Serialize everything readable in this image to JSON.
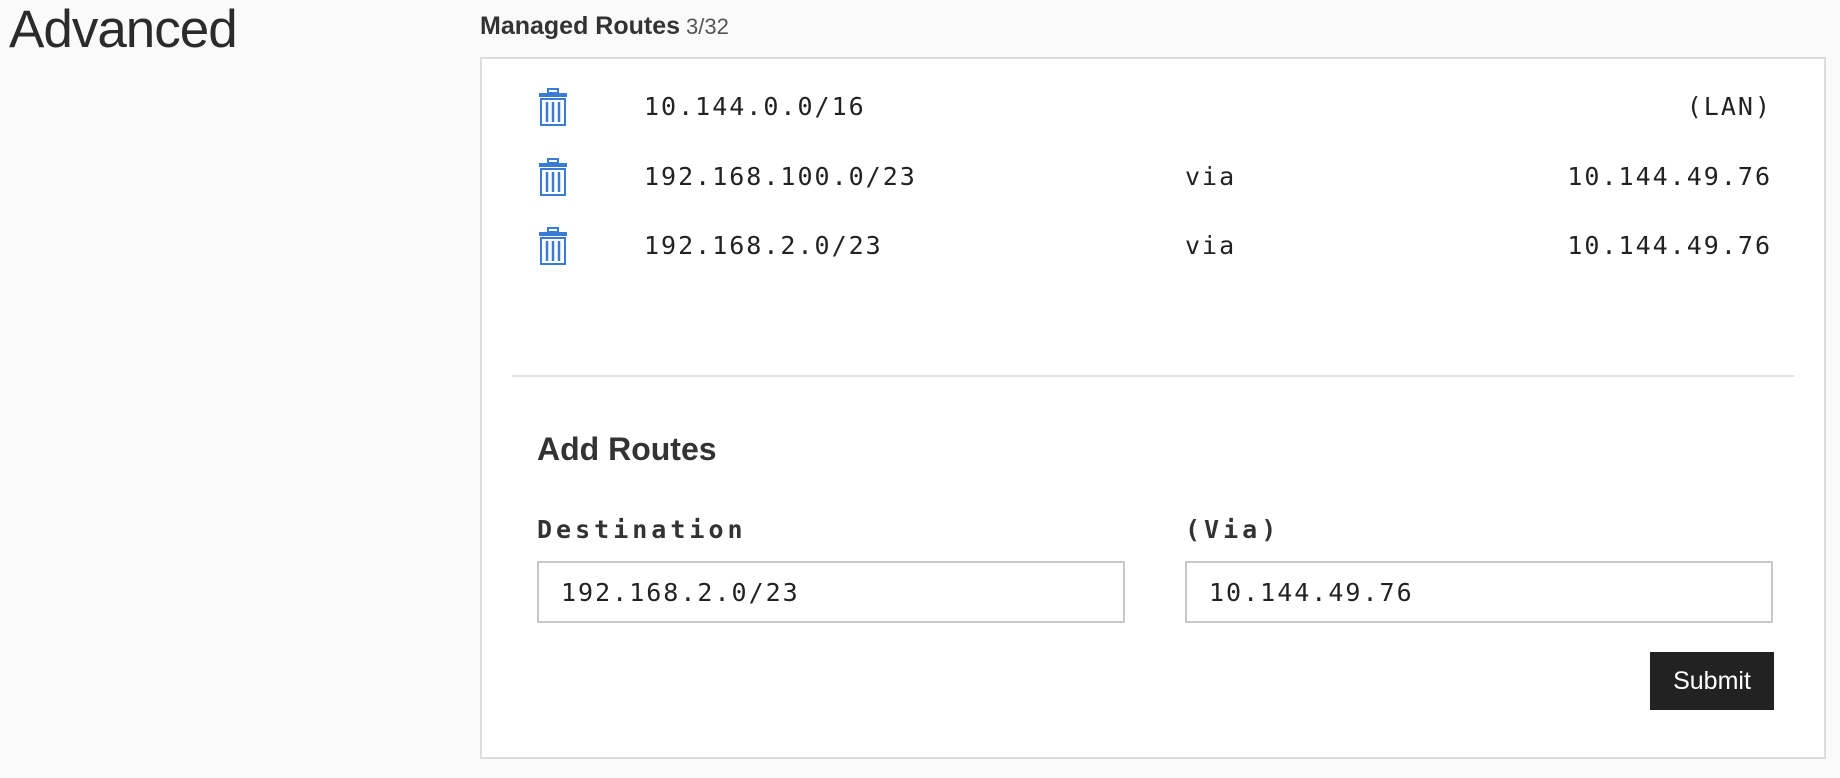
{
  "page": {
    "title": "Advanced"
  },
  "managed_routes": {
    "title": "Managed Routes",
    "count": "3/32",
    "routes": [
      {
        "destination": "10.144.0.0/16",
        "via": "",
        "gateway": "(LAN)",
        "delete_icon": "trash-icon"
      },
      {
        "destination": "192.168.100.0/23",
        "via": "via",
        "gateway": "10.144.49.76",
        "delete_icon": "trash-icon"
      },
      {
        "destination": "192.168.2.0/23",
        "via": "via",
        "gateway": "10.144.49.76",
        "delete_icon": "trash-icon"
      }
    ]
  },
  "add_routes": {
    "title": "Add Routes",
    "destination_label": "Destination",
    "destination_value": "192.168.2.0/23",
    "via_label": "(Via)",
    "via_value": "10.144.49.76",
    "submit_label": "Submit"
  },
  "colors": {
    "accent_icon": "#3a7bd5",
    "button_bg": "#222222",
    "background": "#fafafa"
  }
}
